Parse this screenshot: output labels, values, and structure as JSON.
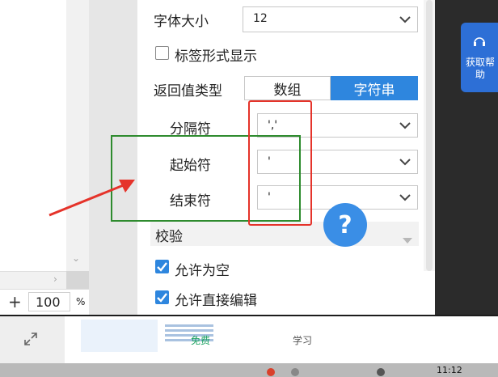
{
  "properties": {
    "font_size_label": "字体大小",
    "font_size_value": "12",
    "tag_display_label": "标签形式显示",
    "tag_display_checked": false,
    "return_type_label": "返回值类型",
    "return_type_options": [
      "数组",
      "字符串"
    ],
    "return_type_selected": "字符串",
    "separator_label": "分隔符",
    "separator_value": "','",
    "start_char_label": "起始符",
    "start_char_value": "'",
    "end_char_label": "结束符",
    "end_char_value": "'",
    "validation_section_label": "校验",
    "allow_empty_label": "允许为空",
    "allow_empty_checked": true,
    "allow_direct_edit_label": "允许直接编辑",
    "allow_direct_edit_checked": true
  },
  "zoom": {
    "plus": "+",
    "value": "100",
    "unit": "%"
  },
  "help": {
    "label": "获取帮助",
    "fab": "?"
  },
  "ad": {
    "free": "免费",
    "learn": "学习"
  },
  "taskbar": {
    "clock": "11:12"
  },
  "colors": {
    "accent": "#2e86de",
    "highlight_red": "#e5332a",
    "highlight_green": "#2e8b2e",
    "free_green": "#1aa260"
  }
}
